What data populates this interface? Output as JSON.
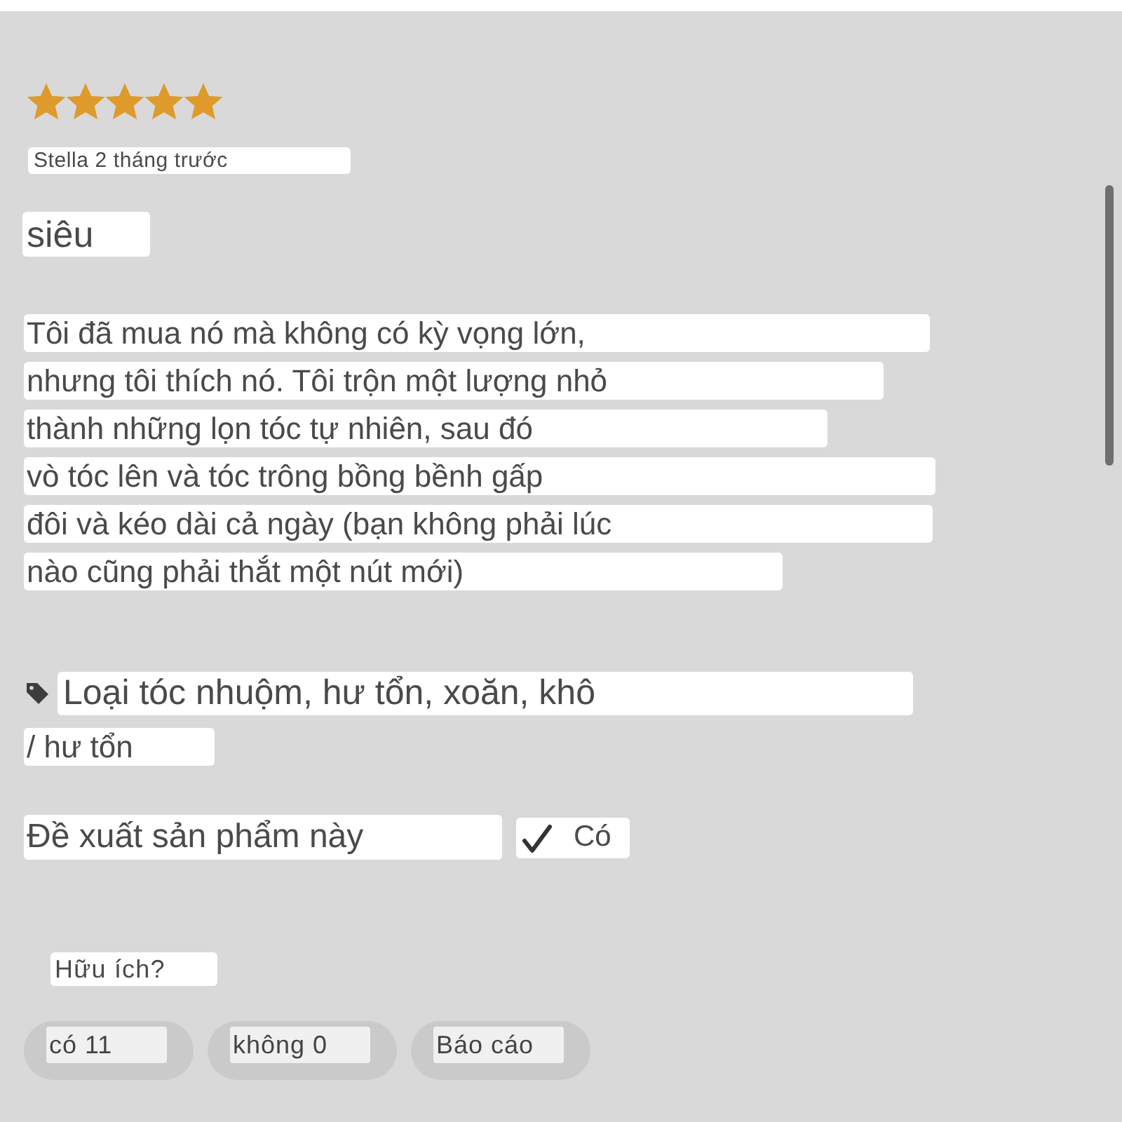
{
  "rating": {
    "stars": 5
  },
  "author_line": "Stella 2 tháng trước",
  "title": "siêu",
  "body_lines": [
    "Tôi đã mua nó mà không có kỳ vọng lớn,",
    "nhưng tôi thích nó. Tôi trộn một lượng nhỏ",
    "thành những lọn tóc tự nhiên, sau đó",
    "vò tóc lên và tóc trông bồng bềnh gấp",
    "đôi và kéo dài cả ngày (bạn không phải lúc",
    "nào cũng phải thắt một nút mới)"
  ],
  "hair_type": {
    "lines": [
      "Loại tóc nhuộm, hư tổn, xoăn, khô",
      "/ hư tổn"
    ]
  },
  "recommend": {
    "label": "Đề xuất sản phẩm này",
    "checked": true,
    "answer": "Có"
  },
  "helpful": {
    "question": "Hữu ích?",
    "buttons": [
      "có 11",
      "không 0",
      "Báo cáo"
    ]
  }
}
